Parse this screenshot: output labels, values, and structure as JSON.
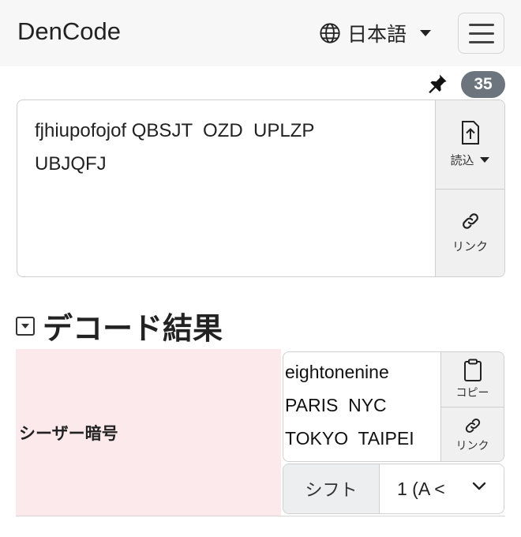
{
  "navbar": {
    "brand": "DenCode",
    "language": "日本語",
    "icons": {
      "globe": "globe-icon",
      "caret": "caret-down-icon",
      "menu": "hamburger-menu-icon"
    }
  },
  "toolbar": {
    "pin_icon": "pin-icon",
    "char_count": "35"
  },
  "input": {
    "value": "fjhiupofojof QBSJT  OZD  UPLZP\nUBJQFJ",
    "load_label": "読込",
    "link_label": "リンク",
    "icons": {
      "load": "file-upload-icon",
      "link": "link-icon"
    }
  },
  "results": {
    "title": "デコード結果",
    "rows": [
      {
        "label": "シーザー暗号",
        "value": "eightonenine\nPARIS  NYC\nTOKYO  TAIPEI",
        "copy_label": "コピー",
        "link_label": "リンク",
        "shift_label": "シフト",
        "shift_value": "1 (A <"
      }
    ]
  },
  "colors": {
    "navbar_bg": "#f7f7f8",
    "badge_bg": "#6c757d",
    "result_label_bg": "#fbe9ec",
    "button_bg": "#f0f0f0"
  }
}
